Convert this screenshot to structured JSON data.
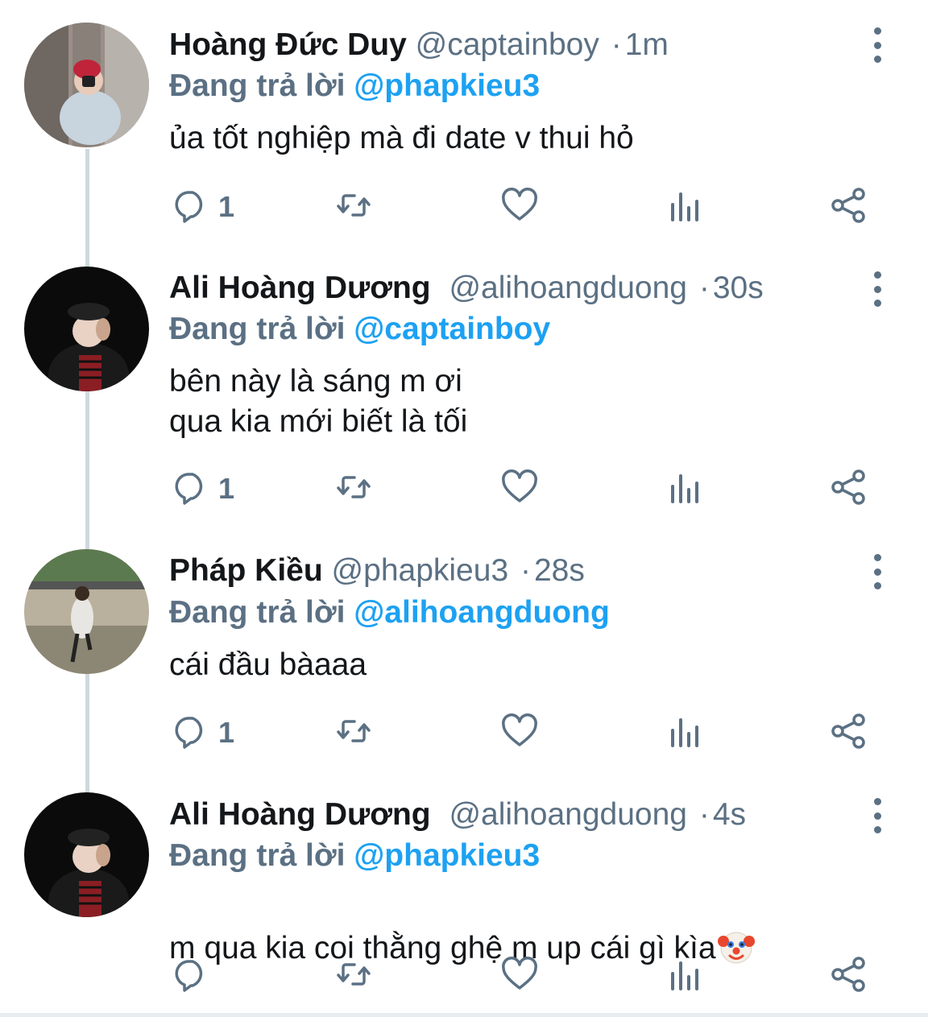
{
  "tweets": [
    {
      "display_name": "Hoàng Đức Duy",
      "handle": "@captainboy",
      "time": "1m",
      "replying_label": "Đang trả lời",
      "replying_to": "@phapkieu3",
      "text": "ủa tốt nghiệp mà đi date v thui hỏ",
      "reply_count": "1",
      "avatar": "selfie-in-elevator"
    },
    {
      "display_name": "Ali Hoàng Dương",
      "handle": "@alihoangduong",
      "time": "30s",
      "replying_label": "Đang trả lời",
      "replying_to": "@captainboy",
      "text": "bên này là sáng m ơi\nqua kia mới biết là tối",
      "reply_count": "1",
      "avatar": "man-with-beret-night"
    },
    {
      "display_name": "Pháp Kiều",
      "handle": "@phapkieu3",
      "time": "28s",
      "replying_label": "Đang trả lời",
      "replying_to": "@alihoangduong",
      "text": "cái đầu bàaaa",
      "reply_count": "1",
      "avatar": "person-posing-by-wall"
    },
    {
      "display_name": "Ali Hoàng Dương",
      "handle": "@alihoangduong",
      "time": "4s",
      "replying_label": "Đang trả lời",
      "replying_to": "@phapkieu3",
      "text": "m qua kia coi thằng ghệ m up cái gì kìa",
      "emoji": "clown-face-emoji",
      "reply_count": "",
      "avatar": "man-with-beret-night"
    }
  ],
  "separator": "·",
  "colors": {
    "name": "#14171a",
    "secondary": "#5b7083",
    "mention": "#1da1f2",
    "thread_line": "#cfd9de"
  },
  "icons": [
    "reply-icon",
    "retweet-icon",
    "like-icon",
    "analytics-icon",
    "share-icon",
    "more-options-icon"
  ]
}
